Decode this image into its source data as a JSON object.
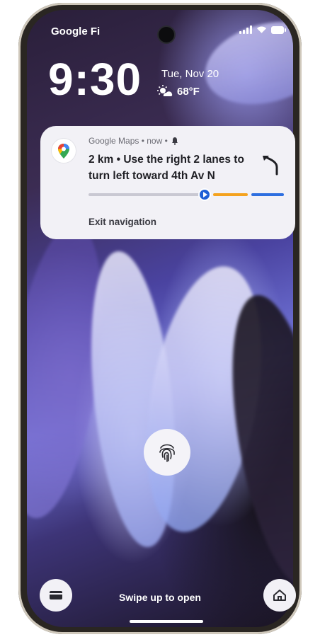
{
  "status_bar": {
    "carrier": "Google Fi",
    "icons": [
      "signal-icon",
      "wifi-icon",
      "battery-icon"
    ]
  },
  "lockscreen": {
    "time": "9:30",
    "date": "Tue, Nov 20",
    "weather": {
      "icon": "partly-sunny-icon",
      "temp": "68°F"
    }
  },
  "notification": {
    "app_name": "Google Maps",
    "meta": "Google Maps • now •",
    "title": "2 km • Use the right 2 lanes to turn left toward 4th Av N",
    "action": "Exit navigation",
    "route_progress": 0.58,
    "colors": {
      "progress_gray": "#c9c8d2",
      "orange": "#f4a21e",
      "blue": "#2e6fe0"
    }
  },
  "bottom": {
    "swipe_text": "Swipe up to open",
    "left_shortcut": "wallet-icon",
    "right_shortcut": "home-icon"
  }
}
